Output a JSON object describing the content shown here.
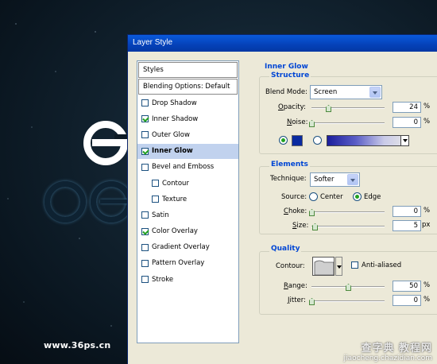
{
  "dialog": {
    "title": "Layer Style"
  },
  "styles_panel": {
    "header": "Styles",
    "blending": "Blending Options: Default",
    "items": [
      {
        "label": "Drop Shadow",
        "checked": false,
        "selected": false,
        "indent": false
      },
      {
        "label": "Inner Shadow",
        "checked": true,
        "selected": false,
        "indent": false
      },
      {
        "label": "Outer Glow",
        "checked": false,
        "selected": false,
        "indent": false
      },
      {
        "label": "Inner Glow",
        "checked": true,
        "selected": true,
        "indent": false
      },
      {
        "label": "Bevel and Emboss",
        "checked": false,
        "selected": false,
        "indent": false
      },
      {
        "label": "Contour",
        "checked": false,
        "selected": false,
        "indent": true
      },
      {
        "label": "Texture",
        "checked": false,
        "selected": false,
        "indent": true
      },
      {
        "label": "Satin",
        "checked": false,
        "selected": false,
        "indent": false
      },
      {
        "label": "Color Overlay",
        "checked": true,
        "selected": false,
        "indent": false
      },
      {
        "label": "Gradient Overlay",
        "checked": false,
        "selected": false,
        "indent": false
      },
      {
        "label": "Pattern Overlay",
        "checked": false,
        "selected": false,
        "indent": false
      },
      {
        "label": "Stroke",
        "checked": false,
        "selected": false,
        "indent": false
      }
    ]
  },
  "inner_glow": {
    "heading": "Inner Glow",
    "structure": {
      "title": "Structure",
      "blend_mode_label": "Blend Mode:",
      "blend_mode_value": "Screen",
      "opacity_label": "Opacity:",
      "opacity_value": "24",
      "opacity_unit": "%",
      "noise_label": "Noise:",
      "noise_value": "0",
      "noise_unit": "%",
      "color_swatch": "#0a2aa0"
    },
    "elements": {
      "title": "Elements",
      "technique_label": "Technique:",
      "technique_value": "Softer",
      "source_label": "Source:",
      "source_center": "Center",
      "source_edge": "Edge",
      "choke_label": "Choke:",
      "choke_value": "0",
      "choke_unit": "%",
      "size_label": "Size:",
      "size_value": "5",
      "size_unit": "px"
    },
    "quality": {
      "title": "Quality",
      "contour_label": "Contour:",
      "anti_aliased": "Anti-aliased",
      "range_label": "Range:",
      "range_value": "50",
      "range_unit": "%",
      "jitter_label": "Jitter:",
      "jitter_value": "0",
      "jitter_unit": "%"
    }
  },
  "watermarks": {
    "left": "www.36ps.cn",
    "right_top": "查字典 教程网",
    "right_bottom": "jiaocheng.chazidian.com"
  }
}
